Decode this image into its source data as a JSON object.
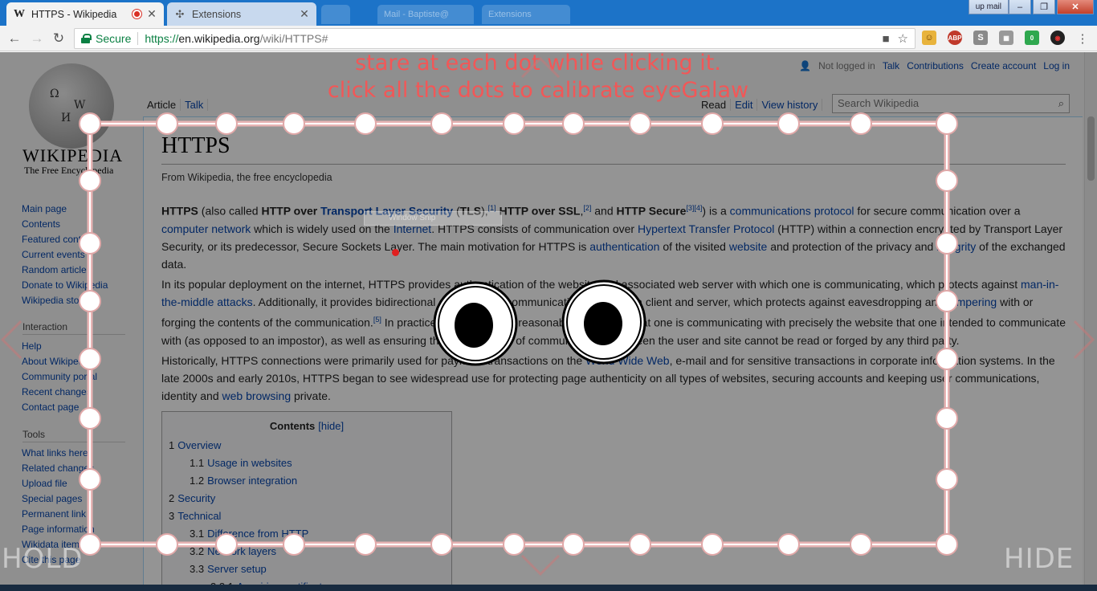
{
  "browser": {
    "tabs": [
      {
        "label": "HTTPS - Wikipedia",
        "favicon": "W",
        "recording": true
      },
      {
        "label": "Extensions"
      }
    ],
    "ghost_tabs": [
      "Mail - Baptiste@",
      "Extensions"
    ],
    "window_buttons": {
      "upmail": "up mail",
      "minimize": "–",
      "restore": "❐",
      "close": "✕"
    },
    "address": {
      "secure_label": "Secure",
      "scheme": "https://",
      "host": "en.wikipedia.org",
      "path": "/wiki/HTTPS#"
    },
    "extensions": [
      {
        "label": "ABP",
        "color": "#c0392b"
      },
      {
        "label": "S",
        "color": "#8a8a8a"
      },
      {
        "label": "0",
        "color": "#2fa84f"
      }
    ]
  },
  "wiki": {
    "wordmark": "WIKIPEDIA",
    "tagline": "The Free Encyclopedia",
    "nav": [
      "Main page",
      "Contents",
      "Featured content",
      "Current events",
      "Random article",
      "Donate to Wikipedia",
      "Wikipedia store"
    ],
    "interaction_head": "Interaction",
    "interaction": [
      "Help",
      "About Wikipedia",
      "Community portal",
      "Recent changes",
      "Contact page"
    ],
    "tools_head": "Tools",
    "tools": [
      "What links here",
      "Related changes",
      "Upload file",
      "Special pages",
      "Permanent link",
      "Page information",
      "Wikidata item",
      "Cite this page"
    ],
    "user_links": {
      "status": "Not logged in",
      "talk": "Talk",
      "contributions": "Contributions",
      "create": "Create account",
      "login": "Log in"
    },
    "tabs_left": [
      "Article",
      "Talk"
    ],
    "tabs_right": [
      "Read",
      "Edit",
      "View history"
    ],
    "search_placeholder": "Search Wikipedia",
    "title": "HTTPS",
    "subtitle": "From Wikipedia, the free encyclopedia",
    "toc": {
      "title": "Contents",
      "hide": "[hide]",
      "items": [
        {
          "num": "1",
          "label": "Overview"
        },
        {
          "num": "1.1",
          "label": "Usage in websites"
        },
        {
          "num": "1.2",
          "label": "Browser integration"
        },
        {
          "num": "2",
          "label": "Security"
        },
        {
          "num": "3",
          "label": "Technical"
        },
        {
          "num": "3.1",
          "label": "Difference from HTTP"
        },
        {
          "num": "3.2",
          "label": "Network layers"
        },
        {
          "num": "3.3",
          "label": "Server setup"
        },
        {
          "num": "3.3.1",
          "label": "Acquiring certificates"
        }
      ]
    }
  },
  "overlay": {
    "instruction_line1": "stare at each dot while clicking it.",
    "instruction_line2": "click all the dots to calibrate eyeGalaw",
    "hold": "HOLD",
    "hide": "HIDE",
    "mini_window": "Window Snip",
    "text_color": "#f25757"
  }
}
